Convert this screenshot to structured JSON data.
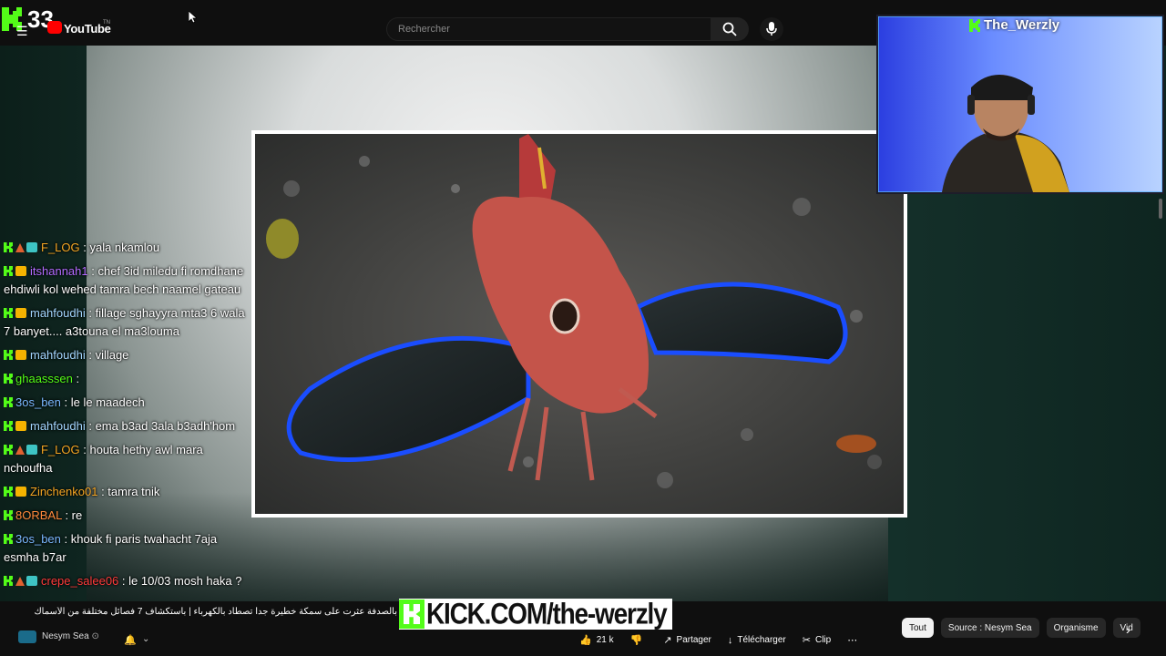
{
  "topbar": {
    "counter": "33",
    "brand": "YouTube",
    "trademark": "TN",
    "search_placeholder": "Rechercher"
  },
  "webcam": {
    "streamer_name": "The_Werzly"
  },
  "chat": [
    {
      "user": "F_LOG",
      "color": "#f5a623",
      "badges": [
        "kick",
        "hat",
        "trophy"
      ],
      "text": "yala nkamlou"
    },
    {
      "user": "itshannah1",
      "color": "#b36bff",
      "badges": [
        "kick",
        "crown"
      ],
      "text": "chef 3id miledu fi romdhane ehdiwli kol wehed tamra bech naamel gateau"
    },
    {
      "user": "mahfoudhi",
      "color": "#a3d6ff",
      "badges": [
        "kick",
        "crown"
      ],
      "text": "fillage sghayyra mta3 6 wala 7 banyet.... a3touna el ma3louma"
    },
    {
      "user": "mahfoudhi",
      "color": "#a3d6ff",
      "badges": [
        "kick",
        "crown"
      ],
      "text": "village"
    },
    {
      "user": "ghaasssen",
      "color": "#53fc18",
      "badges": [
        "kick"
      ],
      "text": ""
    },
    {
      "user": "3os_ben",
      "color": "#7ab8ff",
      "badges": [
        "kick"
      ],
      "text": "le le maadech"
    },
    {
      "user": "mahfoudhi",
      "color": "#a3d6ff",
      "badges": [
        "kick",
        "crown"
      ],
      "text": "ema b3ad 3ala b3adh'hom"
    },
    {
      "user": "F_LOG",
      "color": "#f5a623",
      "badges": [
        "kick",
        "hat",
        "trophy"
      ],
      "text": "houta hethy awl mara nchoufha"
    },
    {
      "user": "Zinchenko01",
      "color": "#f5a623",
      "badges": [
        "kick",
        "crown"
      ],
      "text": "tamra tnik"
    },
    {
      "user": "8ORBAL",
      "color": "#ff8a3c",
      "badges": [
        "kick"
      ],
      "text": "re"
    },
    {
      "user": "3os_ben",
      "color": "#7ab8ff",
      "badges": [
        "kick"
      ],
      "text": "khouk fi paris twahacht 7aja esmha b7ar"
    },
    {
      "user": "crepe_salee06",
      "color": "#ff3b3b",
      "badges": [
        "kick",
        "hat",
        "trophy"
      ],
      "text": "le 10/03 mosh haka ?"
    }
  ],
  "ticker_text": "بالصدفة عثرت على سمكة خطيرة جدا تصطاد بالكهرباء | باستكشاف 7 فصائل مختلفة من الأسماك",
  "kick_banner": "KICK.COM/the-werzly",
  "channel": {
    "name": "Nesym Sea"
  },
  "actions": [
    {
      "icon": "like-icon",
      "glyph": "👍",
      "label": "21 k"
    },
    {
      "icon": "dislike-icon",
      "glyph": "👎",
      "label": ""
    },
    {
      "icon": "share-icon",
      "glyph": "↗",
      "label": "Partager"
    },
    {
      "icon": "download-icon",
      "glyph": "↓",
      "label": "Télécharger"
    },
    {
      "icon": "clip-icon",
      "glyph": "✂",
      "label": "Clip"
    },
    {
      "icon": "more-icon",
      "glyph": "⋯",
      "label": ""
    }
  ],
  "chips": [
    "Tout",
    "Source : Nesym Sea",
    "Organisme",
    "Vid"
  ],
  "colors": {
    "kick_green": "#53fc18",
    "youtube_red": "#ff0000"
  }
}
